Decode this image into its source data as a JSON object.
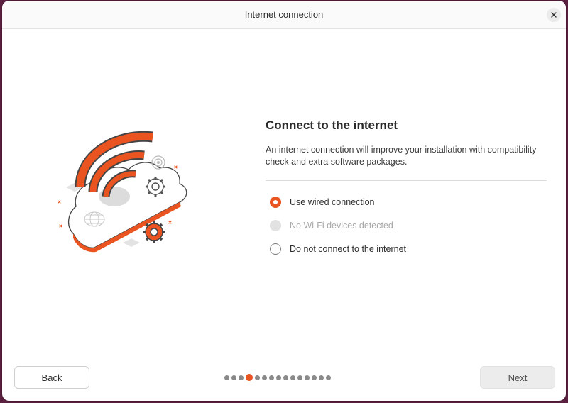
{
  "window": {
    "title": "Internet connection",
    "close_icon": "close-icon"
  },
  "main": {
    "heading": "Connect to the internet",
    "description": "An internet connection will improve your installation with compatibility check and extra software packages.",
    "options": [
      {
        "label": "Use wired connection",
        "checked": true,
        "disabled": false
      },
      {
        "label": "No Wi-Fi devices detected",
        "checked": false,
        "disabled": true
      },
      {
        "label": "Do not connect to the internet",
        "checked": false,
        "disabled": false
      }
    ]
  },
  "footer": {
    "back_label": "Back",
    "next_label": "Next",
    "progress": {
      "total_steps": 15,
      "current_step": 4
    }
  },
  "colors": {
    "accent": "#e95420",
    "background": "#5a1f3f"
  }
}
